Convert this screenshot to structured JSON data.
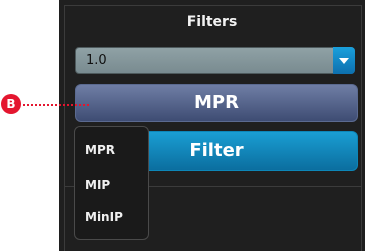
{
  "filters": {
    "title": "Filters",
    "value_select": {
      "value": "1.0"
    },
    "mode_button": "MPR",
    "filter_button": "Filter",
    "dropdown_options": [
      "MPR",
      "MIP",
      "MinIP"
    ]
  },
  "annotation": {
    "badge": "B",
    "color": "#e4162f"
  },
  "colors": {
    "panel_bg": "#1f1f1f",
    "accent_blue": "#1a9ed3",
    "mode_button_bg": "#5a6a92"
  }
}
